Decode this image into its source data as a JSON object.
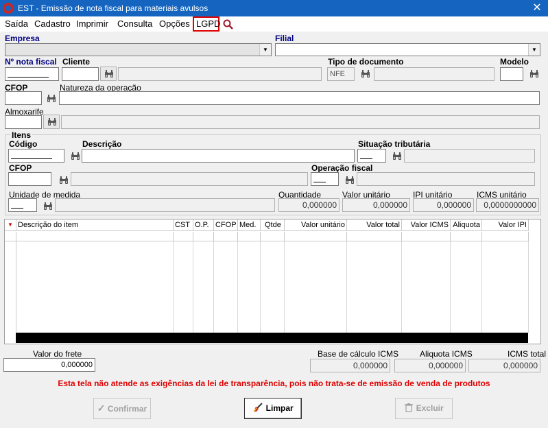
{
  "window": {
    "title": "EST - Emissão de nota fiscal para materiais avulsos",
    "close_glyph": "✕"
  },
  "menu": {
    "items": [
      "Saída",
      "Cadastro",
      "Imprimir",
      "Consulta",
      "Opções",
      "LGPD"
    ]
  },
  "form": {
    "empresa_label": "Empresa",
    "filial_label": "Filial",
    "nota_label": "Nº nota fiscal",
    "cliente_label": "Cliente",
    "tipo_doc_label": "Tipo de documento",
    "tipo_doc_value": "NFE",
    "modelo_label": "Modelo",
    "cfop_label": "CFOP",
    "natureza_label": "Natureza da operação",
    "almox_label": "Almoxarife"
  },
  "itens": {
    "title": "Itens",
    "codigo_label": "Código",
    "descricao_label": "Descrição",
    "sit_trib_label": "Situação tributária",
    "cfop_label": "CFOP",
    "op_fiscal_label": "Operação fiscal",
    "unidade_label": "Unidade de medida",
    "quantidade_label": "Quantidade",
    "quantidade_value": "0,000000",
    "valor_unit_label": "Valor unitário",
    "valor_unit_value": "0,000000",
    "ipi_unit_label": "IPI unitário",
    "ipi_unit_value": "0,000000",
    "icms_unit_label": "ICMS unitário",
    "icms_unit_value": "0,0000000000"
  },
  "grid": {
    "columns": [
      "Descrição do item",
      "CST",
      "O.P.",
      "CFOP",
      "Med.",
      "Qtde",
      "Valor unitário",
      "Valor total",
      "Valor ICMS",
      "Aliquota",
      "Valor IPI"
    ],
    "rows": []
  },
  "totals": {
    "frete_label": "Valor do frete",
    "frete_value": "0,000000",
    "base_icms_label": "Base de cálculo ICMS",
    "base_icms_value": "0,000000",
    "aliquota_label": "Aliquota ICMS",
    "aliquota_value": "0,000000",
    "icms_total_label": "ICMS total",
    "icms_total_value": "0,000000"
  },
  "warning": "Esta tela não atende as exigências da lei de transparência, pois não trata-se de emissão de venda de produtos",
  "buttons": {
    "confirmar": "Confirmar",
    "limpar": "Limpar",
    "excluir": "Excluir"
  },
  "colors": {
    "titlebar": "#1565c0",
    "warning": "#e00000",
    "lgpd_border": "#e00000",
    "label_blue": "#000080"
  }
}
